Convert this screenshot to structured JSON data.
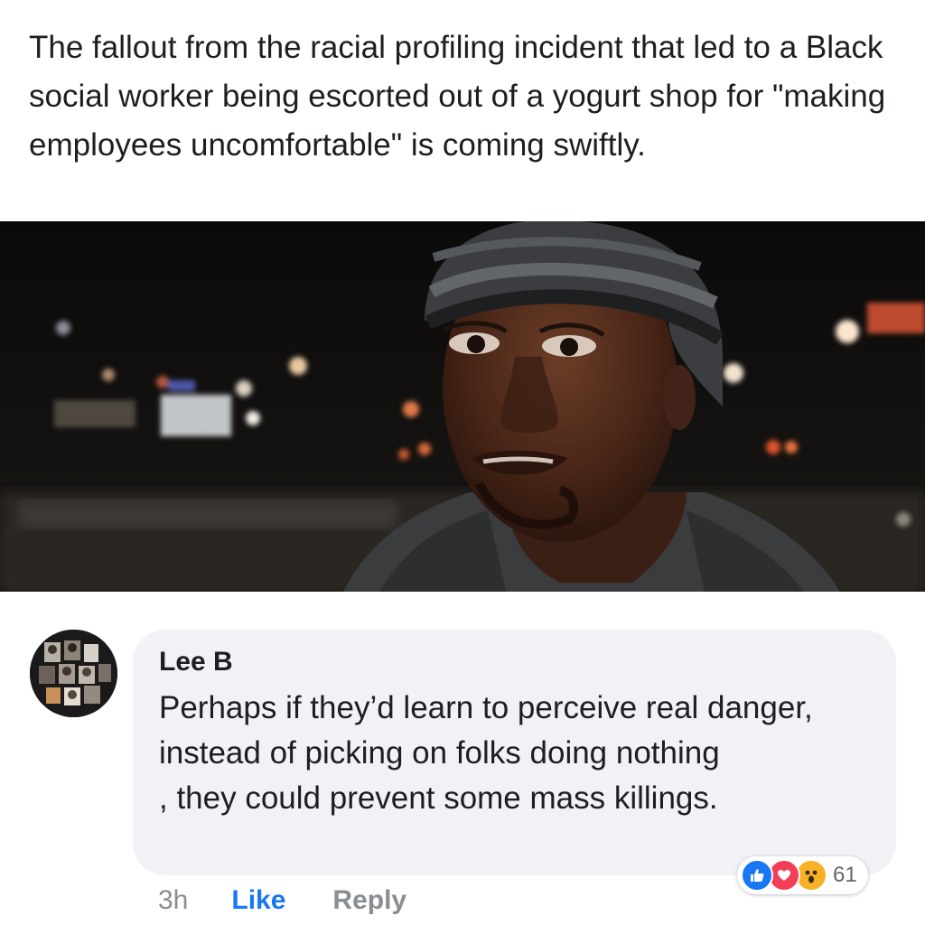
{
  "post": {
    "text": "The fallout from the racial profiling incident that led to a Black social worker being escorted out of a yogurt shop for \"making employees uncomfortable\" is coming swiftly."
  },
  "comment": {
    "author": "Lee B",
    "text": "Perhaps if they’d learn to perceive real danger, instead of picking on folks doing nothing\n, they could prevent some mass killings.",
    "time": "3h",
    "like_label": "Like",
    "reply_label": "Reply",
    "reaction_count": "61",
    "reactions": [
      "like-icon",
      "love-icon",
      "wow-icon"
    ]
  },
  "colors": {
    "link_blue": "#1877f2",
    "bubble_bg": "#f0f2f5",
    "muted_text": "#8a8d91",
    "love_red": "#f33e58",
    "wow_yellow": "#f7b125"
  }
}
